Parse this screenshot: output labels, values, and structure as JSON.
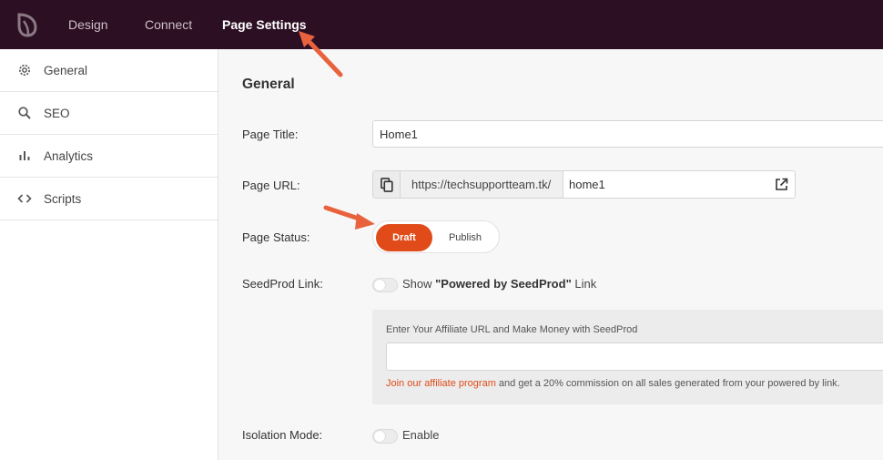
{
  "topbar": {
    "logo": "seedprod-leaf-logo",
    "tabs": [
      {
        "label": "Design"
      },
      {
        "label": "Connect"
      },
      {
        "label": "Page Settings",
        "active": true
      }
    ]
  },
  "sidebar": {
    "items": [
      {
        "label": "General",
        "icon": "gear-icon"
      },
      {
        "label": "SEO",
        "icon": "search-icon"
      },
      {
        "label": "Analytics",
        "icon": "bar-chart-icon"
      },
      {
        "label": "Scripts",
        "icon": "code-icon"
      }
    ]
  },
  "main": {
    "section_title": "General",
    "page_title": {
      "label": "Page Title:",
      "value": "Home1"
    },
    "page_url": {
      "label": "Page URL:",
      "prefix": "https://techsupportteam.tk/",
      "value": "home1"
    },
    "page_status": {
      "label": "Page Status:",
      "options": [
        "Draft",
        "Publish"
      ],
      "selected": "Draft"
    },
    "seedprod_link": {
      "label": "SeedProd Link:",
      "toggle_text_before": "Show ",
      "toggle_text_bold": "\"Powered by SeedProd\"",
      "toggle_text_after": " Link",
      "enabled": false
    },
    "affiliate": {
      "label": "Enter Your Affiliate URL and Make Money with SeedProd",
      "value": "",
      "link_text": "Join our affiliate program",
      "note_rest": " and get a 20% commission on all sales generated from your powered by link."
    },
    "isolation_mode": {
      "label": "Isolation Mode:",
      "toggle_text": "Enable",
      "enabled": false
    }
  },
  "colors": {
    "topbar": "#2d0f23",
    "accent": "#e04b19",
    "annotation_arrow": "#e8633d"
  }
}
